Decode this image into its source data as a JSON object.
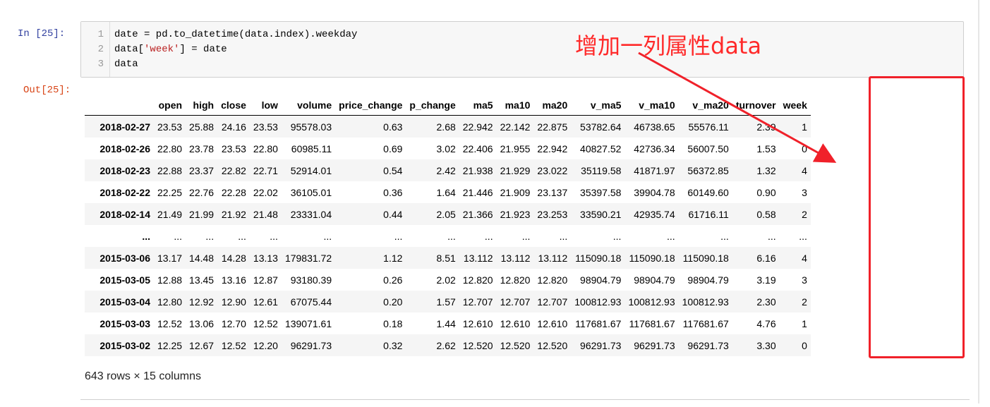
{
  "cell": {
    "in_prompt": "In  [25]:",
    "out_prompt": "Out[25]:",
    "code_lines": [
      {
        "num": "1",
        "text": "date = pd.to_datetime(data.index).weekday"
      },
      {
        "num": "2",
        "pre": "data[",
        "str": "'week'",
        "post": "] = date"
      },
      {
        "num": "3",
        "text": "data"
      }
    ]
  },
  "dataframe": {
    "columns": [
      "open",
      "high",
      "close",
      "low",
      "volume",
      "price_change",
      "p_change",
      "ma5",
      "ma10",
      "ma20",
      "v_ma5",
      "v_ma10",
      "v_ma20",
      "turnover",
      "week"
    ],
    "rows": [
      {
        "index": "2018-02-27",
        "cells": [
          "23.53",
          "25.88",
          "24.16",
          "23.53",
          "95578.03",
          "0.63",
          "2.68",
          "22.942",
          "22.142",
          "22.875",
          "53782.64",
          "46738.65",
          "55576.11",
          "2.39",
          "1"
        ]
      },
      {
        "index": "2018-02-26",
        "cells": [
          "22.80",
          "23.78",
          "23.53",
          "22.80",
          "60985.11",
          "0.69",
          "3.02",
          "22.406",
          "21.955",
          "22.942",
          "40827.52",
          "42736.34",
          "56007.50",
          "1.53",
          "0"
        ]
      },
      {
        "index": "2018-02-23",
        "cells": [
          "22.88",
          "23.37",
          "22.82",
          "22.71",
          "52914.01",
          "0.54",
          "2.42",
          "21.938",
          "21.929",
          "23.022",
          "35119.58",
          "41871.97",
          "56372.85",
          "1.32",
          "4"
        ]
      },
      {
        "index": "2018-02-22",
        "cells": [
          "22.25",
          "22.76",
          "22.28",
          "22.02",
          "36105.01",
          "0.36",
          "1.64",
          "21.446",
          "21.909",
          "23.137",
          "35397.58",
          "39904.78",
          "60149.60",
          "0.90",
          "3"
        ]
      },
      {
        "index": "2018-02-14",
        "cells": [
          "21.49",
          "21.99",
          "21.92",
          "21.48",
          "23331.04",
          "0.44",
          "2.05",
          "21.366",
          "21.923",
          "23.253",
          "33590.21",
          "42935.74",
          "61716.11",
          "0.58",
          "2"
        ]
      },
      {
        "index": "...",
        "cells": [
          "...",
          "...",
          "...",
          "...",
          "...",
          "...",
          "...",
          "...",
          "...",
          "...",
          "...",
          "...",
          "...",
          "...",
          "..."
        ]
      },
      {
        "index": "2015-03-06",
        "cells": [
          "13.17",
          "14.48",
          "14.28",
          "13.13",
          "179831.72",
          "1.12",
          "8.51",
          "13.112",
          "13.112",
          "13.112",
          "115090.18",
          "115090.18",
          "115090.18",
          "6.16",
          "4"
        ]
      },
      {
        "index": "2015-03-05",
        "cells": [
          "12.88",
          "13.45",
          "13.16",
          "12.87",
          "93180.39",
          "0.26",
          "2.02",
          "12.820",
          "12.820",
          "12.820",
          "98904.79",
          "98904.79",
          "98904.79",
          "3.19",
          "3"
        ]
      },
      {
        "index": "2015-03-04",
        "cells": [
          "12.80",
          "12.92",
          "12.90",
          "12.61",
          "67075.44",
          "0.20",
          "1.57",
          "12.707",
          "12.707",
          "12.707",
          "100812.93",
          "100812.93",
          "100812.93",
          "2.30",
          "2"
        ]
      },
      {
        "index": "2015-03-03",
        "cells": [
          "12.52",
          "13.06",
          "12.70",
          "12.52",
          "139071.61",
          "0.18",
          "1.44",
          "12.610",
          "12.610",
          "12.610",
          "117681.67",
          "117681.67",
          "117681.67",
          "4.76",
          "1"
        ]
      },
      {
        "index": "2015-03-02",
        "cells": [
          "12.25",
          "12.67",
          "12.52",
          "12.20",
          "96291.73",
          "0.32",
          "2.62",
          "12.520",
          "12.520",
          "12.520",
          "96291.73",
          "96291.73",
          "96291.73",
          "3.30",
          "0"
        ]
      }
    ],
    "shape_text": "643 rows × 15 columns"
  },
  "annotation": {
    "text": "增加一列属性data",
    "color": "#ff2a2a"
  }
}
